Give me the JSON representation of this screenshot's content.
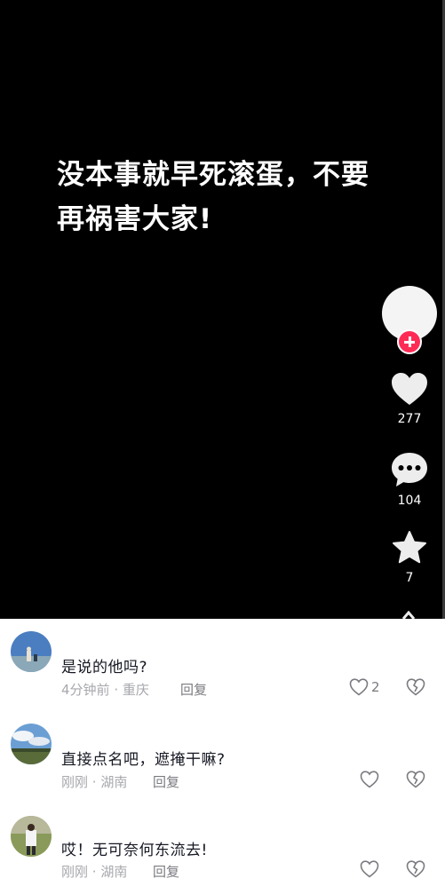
{
  "video": {
    "caption_line1": "没本事就早死滚蛋，不要",
    "caption_line2": "再祸害大家!",
    "background": "#000000"
  },
  "actions": {
    "like_icon": "heart-icon",
    "like_count": "277",
    "comment_icon": "speech-bubble-icon",
    "comment_count": "104",
    "favorite_icon": "star-icon",
    "favorite_count": "7",
    "follow_icon": "plus-icon",
    "follow_color": "#fe2c55"
  },
  "comments": [
    {
      "text": "是说的他吗?",
      "time": "4分钟前",
      "location": "重庆",
      "reply_label": "回复",
      "likes": "2"
    },
    {
      "text": "直接点名吧，遮掩干嘛?",
      "time": "刚刚",
      "location": "湖南",
      "reply_label": "回复",
      "likes": ""
    },
    {
      "text": "哎！无可奈何东流去!",
      "time": "刚刚",
      "location": "湖南",
      "reply_label": "回复",
      "likes": ""
    }
  ]
}
